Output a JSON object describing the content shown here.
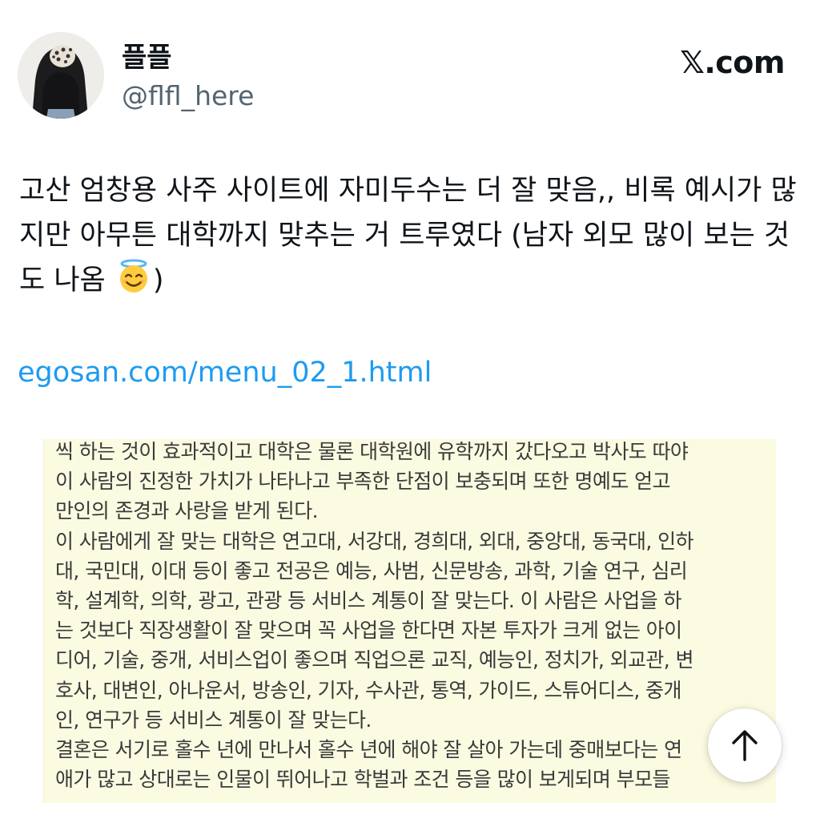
{
  "author": {
    "display_name": "플플",
    "handle": "@flfl_here"
  },
  "brand": {
    "label": ".com",
    "glyph": "𝕏"
  },
  "tweet": {
    "text_before_emoji": "고산 엄창용 사주 사이트에 자미두수는 더 잘 맞음,, 비록 예시가 많지만 아무튼 대학까지 맞추는 거 트루였다 (남자 외모 많이 보는 것도 나옴 ",
    "emoji": "smiling-face-with-halo",
    "text_after_emoji": ")",
    "link": "egosan.com/menu_02_1.html"
  },
  "scan_image": {
    "lines": [
      "씩 하는 것이 효과적이고 대학은 물론 대학원에 유학까지 갔다오고 박사도 따야",
      "이 사람의 진정한 가치가 나타나고 부족한 단점이 보충되며 또한 명예도 얻고",
      "만인의 존경과 사랑을 받게 된다.",
      "이 사람에게 잘 맞는 대학은 연고대, 서강대, 경희대, 외대, 중앙대, 동국대, 인하",
      "대, 국민대, 이대 등이 좋고 전공은 예능, 사범, 신문방송, 과학, 기술 연구, 심리",
      "학, 설계학, 의학, 광고, 관광 등 서비스 계통이 잘 맞는다. 이 사람은 사업을 하",
      "는 것보다 직장생활이 잘 맞으며 꼭 사업을 한다면 자본 투자가 크게 없는 아이",
      "디어, 기술, 중개, 서비스업이 좋으며 직업으론 교직, 예능인, 정치가, 외교관, 변",
      "호사, 대변인, 아나운서, 방송인, 기자, 수사관, 통역, 가이드, 스튜어디스, 중개",
      "인, 연구가 등 서비스 계통이 잘 맞는다.",
      "결혼은 서기로 홀수 년에 만나서 홀수 년에 해야 잘 살아 가는데 중매보다는 연",
      "애가 많고 상대로는 인물이 뛰어나고 학벌과 조건 등을 많이 보게되며 부모들"
    ]
  },
  "controls": {
    "scroll_top_icon": "arrow-up-icon"
  }
}
